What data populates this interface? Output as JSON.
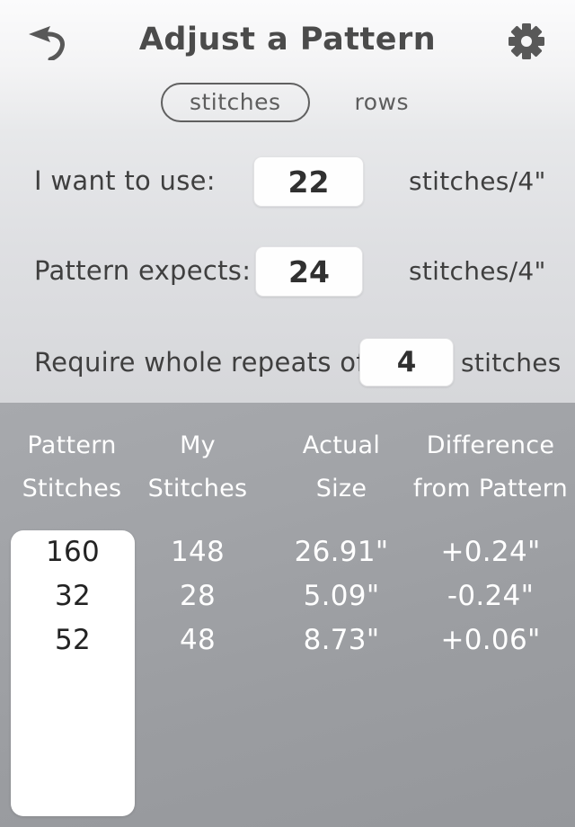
{
  "header": {
    "title": "Adjust a Pattern",
    "back_icon": "back-arrow-icon",
    "settings_icon": "gear-icon"
  },
  "segmented_control": {
    "options": [
      {
        "label": "stitches",
        "selected": true
      },
      {
        "label": "rows",
        "selected": false
      }
    ]
  },
  "form": {
    "rows": [
      {
        "label": "I want to use:",
        "value": "22",
        "unit": "stitches/4\""
      },
      {
        "label": "Pattern expects:",
        "value": "24",
        "unit": "stitches/4\""
      },
      {
        "label": "Require whole repeats of:",
        "value": "4",
        "unit": "stitches"
      }
    ]
  },
  "table": {
    "headers": [
      {
        "line1": "Pattern",
        "line2": "Stitches"
      },
      {
        "line1": "My",
        "line2": "Stitches"
      },
      {
        "line1": "Actual",
        "line2": "Size"
      },
      {
        "line1": "Difference",
        "line2": "from Pattern"
      }
    ],
    "rows": [
      {
        "pattern_stitches": "160",
        "my_stitches": "148",
        "actual_size": "26.91\"",
        "difference": "+0.24\""
      },
      {
        "pattern_stitches": "32",
        "my_stitches": "28",
        "actual_size": "5.09\"",
        "difference": "-0.24\""
      },
      {
        "pattern_stitches": "52",
        "my_stitches": "48",
        "actual_size": "8.73\"",
        "difference": "+0.06\""
      }
    ]
  },
  "colors": {
    "header_bg": "#f7f7f8",
    "form_bg": "#dcdde0",
    "results_bg": "#a0a2a6",
    "text_dark": "#3f3f3f",
    "text_light": "#ffffff",
    "input_bg": "#fefefe"
  }
}
